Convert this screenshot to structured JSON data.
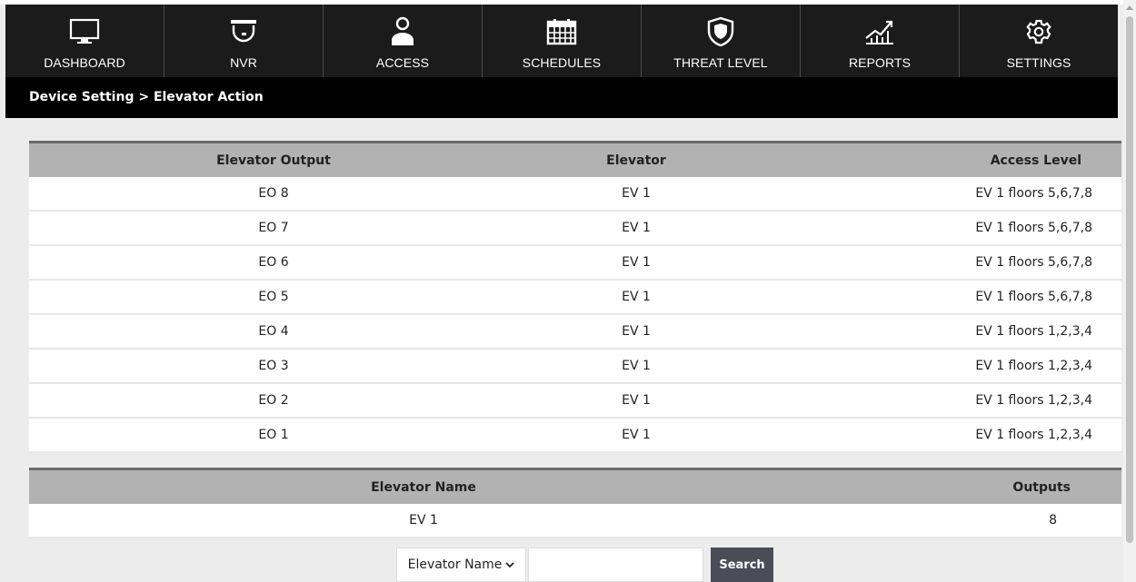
{
  "nav": [
    {
      "label": "DASHBOARD",
      "icon": "monitor-icon"
    },
    {
      "label": "NVR",
      "icon": "camera-dome-icon"
    },
    {
      "label": "ACCESS",
      "icon": "user-icon"
    },
    {
      "label": "SCHEDULES",
      "icon": "calendar-icon"
    },
    {
      "label": "THREAT LEVEL",
      "icon": "shield-icon"
    },
    {
      "label": "REPORTS",
      "icon": "chart-icon"
    },
    {
      "label": "SETTINGS",
      "icon": "gear-icon"
    }
  ],
  "breadcrumb": "Device Setting > Elevator Action",
  "outputs_table": {
    "headers": [
      "Elevator Output",
      "Elevator",
      "Access Level"
    ],
    "rows": [
      [
        "EO 8",
        "EV 1",
        "EV 1 floors 5,6,7,8"
      ],
      [
        "EO 7",
        "EV 1",
        "EV 1 floors 5,6,7,8"
      ],
      [
        "EO 6",
        "EV 1",
        "EV 1 floors 5,6,7,8"
      ],
      [
        "EO 5",
        "EV 1",
        "EV 1 floors 5,6,7,8"
      ],
      [
        "EO 4",
        "EV 1",
        "EV 1 floors 1,2,3,4"
      ],
      [
        "EO 3",
        "EV 1",
        "EV 1 floors 1,2,3,4"
      ],
      [
        "EO 2",
        "EV 1",
        "EV 1 floors 1,2,3,4"
      ],
      [
        "EO 1",
        "EV 1",
        "EV 1 floors 1,2,3,4"
      ]
    ]
  },
  "elevators_table": {
    "headers": [
      "Elevator Name",
      "Outputs"
    ],
    "rows": [
      [
        "EV 1",
        "8"
      ]
    ]
  },
  "search": {
    "select_value": "Elevator Name",
    "input_value": "",
    "button_label": "Search"
  },
  "colors": {
    "navbar_bg": "#1b1b1b",
    "header_bg": "#b2b2b2",
    "search_button_bg": "#4a4d58"
  }
}
